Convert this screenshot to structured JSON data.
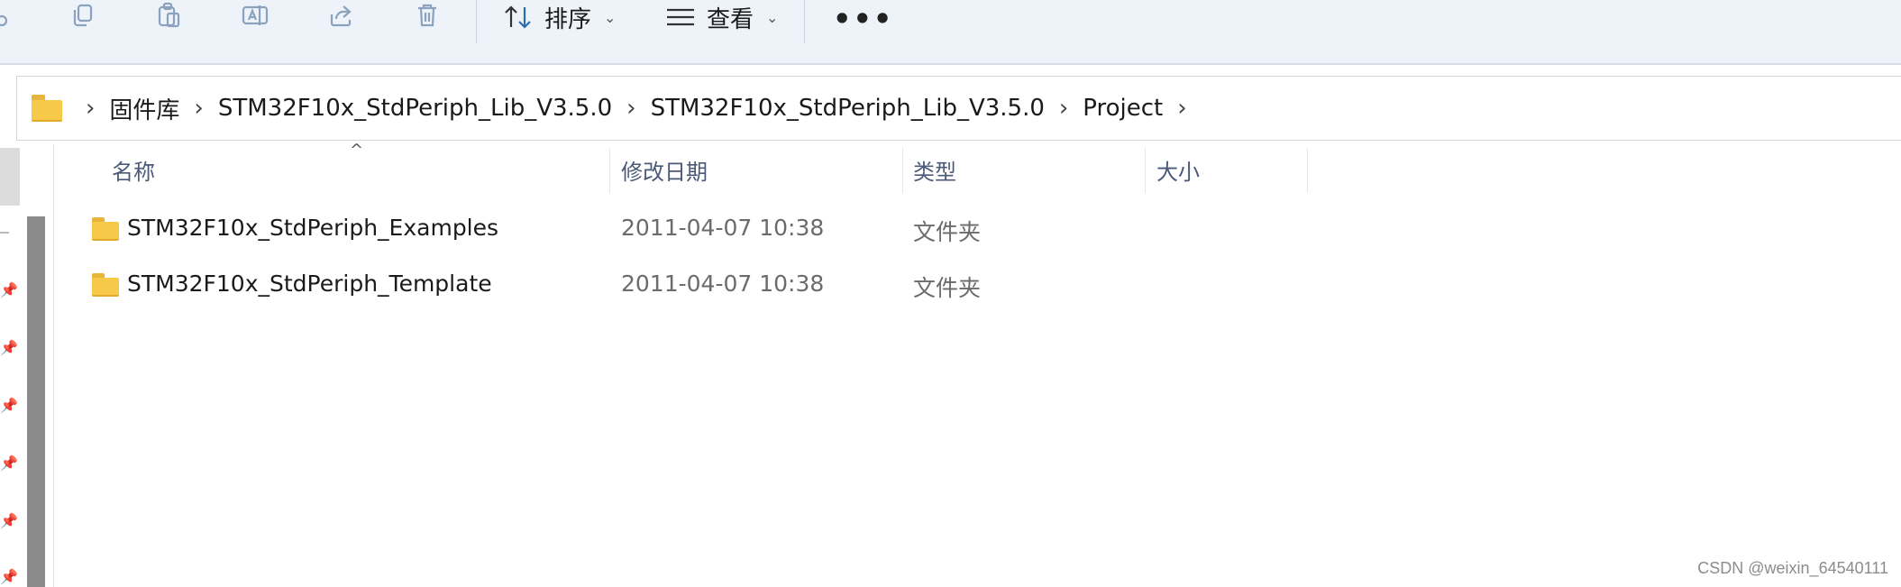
{
  "toolbar": {
    "icons": [
      "share-link-icon",
      "copy-icon",
      "paste-icon",
      "rename-icon",
      "share-icon",
      "delete-icon"
    ],
    "sort_label": "排序",
    "view_label": "查看",
    "more_label": "•••"
  },
  "address_bar": {
    "crumbs": [
      "固件库",
      "STM32F10x_StdPeriph_Lib_V3.5.0",
      "STM32F10x_StdPeriph_Lib_V3.5.0",
      "Project"
    ]
  },
  "columns": {
    "name": "名称",
    "modified": "修改日期",
    "type": "类型",
    "size": "大小"
  },
  "files": [
    {
      "name": "STM32F10x_StdPeriph_Examples",
      "modified": "2011-04-07 10:38",
      "type": "文件夹",
      "size": ""
    },
    {
      "name": "STM32F10x_StdPeriph_Template",
      "modified": "2011-04-07 10:38",
      "type": "文件夹",
      "size": ""
    }
  ],
  "watermark": "CSDN @weixin_64540111",
  "colors": {
    "toolbar_bg": "#eef3f9",
    "folder": "#f7c948",
    "header_text": "#4a5a78",
    "secondary_text": "#6b6b6b"
  }
}
